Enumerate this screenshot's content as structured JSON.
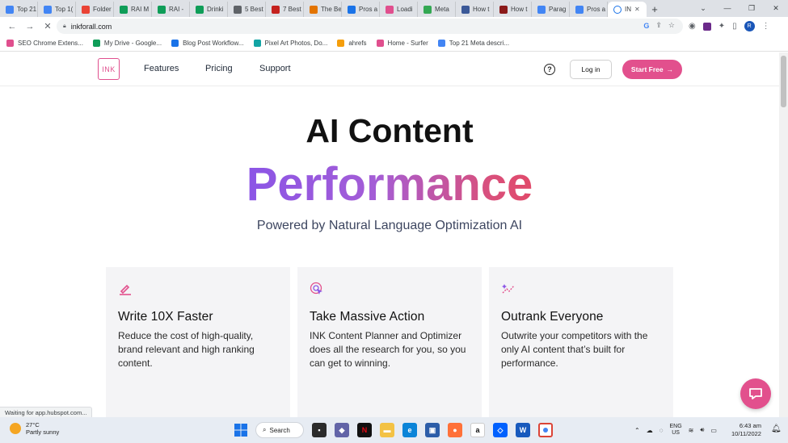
{
  "browser": {
    "tabs": [
      {
        "title": "Top 21",
        "color": "#4285f4"
      },
      {
        "title": "Top 1(",
        "color": "#4285f4"
      },
      {
        "title": "Folder",
        "color": "#ea4335"
      },
      {
        "title": "RAI M",
        "color": "#0f9d58"
      },
      {
        "title": "RAI -",
        "color": "#0f9d58"
      },
      {
        "title": "Drinki",
        "color": "#0f9d58"
      },
      {
        "title": "5 Best",
        "color": "#5f6368"
      },
      {
        "title": "7 Best",
        "color": "#c5221f"
      },
      {
        "title": "The Be",
        "color": "#e37400"
      },
      {
        "title": "Pros a",
        "color": "#1a73e8"
      },
      {
        "title": "Loadi",
        "color": "#e04f8e"
      },
      {
        "title": "Meta",
        "color": "#34a853"
      },
      {
        "title": "How t",
        "color": "#3b5998"
      },
      {
        "title": "How t",
        "color": "#8b1a1a"
      },
      {
        "title": "Parag",
        "color": "#4285f4"
      },
      {
        "title": "Pros a",
        "color": "#4285f4"
      }
    ],
    "active_tab": {
      "title": "IN",
      "close": "✕"
    },
    "new_tab": "+",
    "window_controls": {
      "chevron": "⌄",
      "minimize": "—",
      "restore": "❐",
      "close": "✕"
    },
    "url": "inkforall.com",
    "bookmarks": [
      {
        "label": "SEO Chrome Extens...",
        "color": "#e04f8e"
      },
      {
        "label": "My Drive - Google...",
        "color": "#0f9d58"
      },
      {
        "label": "Blog Post Workflow...",
        "color": "#1a73e8"
      },
      {
        "label": "Pixel Art Photos, Do...",
        "color": "#12a4a4"
      },
      {
        "label": "ahrefs",
        "color": "#f59e0b"
      },
      {
        "label": "Home - Surfer",
        "color": "#e04f8e"
      },
      {
        "label": "Top 21 Meta descri...",
        "color": "#4285f4"
      }
    ],
    "status_text": "Waiting for app.hubspot.com..."
  },
  "site": {
    "logo_text": "INK",
    "nav": [
      "Features",
      "Pricing",
      "Support"
    ],
    "help_glyph": "?",
    "login_label": "Log in",
    "start_label": "Start Free",
    "start_arrow": "→",
    "accent_color": "#e2508d"
  },
  "hero": {
    "title": "AI Content",
    "accent": "Performance",
    "subtitle": "Powered by Natural Language Optimization AI"
  },
  "cards": [
    {
      "icon": "pencil-icon",
      "title": "Write 10X Faster",
      "body": "Reduce the cost of high-quality, brand relevant and high ranking content."
    },
    {
      "icon": "target-cursor-icon",
      "title": "Take Massive Action",
      "body": "INK Content Planner and Optimizer does all the research for you, so you can get to winning."
    },
    {
      "icon": "sparkle-chart-icon",
      "title": "Outrank Everyone",
      "body": "Outwrite your competitors with the only AI content that’s built for performance."
    }
  ],
  "taskbar": {
    "temperature": "27°C",
    "weather": "Partly sunny",
    "search_label": "Search",
    "lang_top": "ENG",
    "lang_bottom": "US",
    "time": "6:43 am",
    "date": "10/11/2022"
  }
}
